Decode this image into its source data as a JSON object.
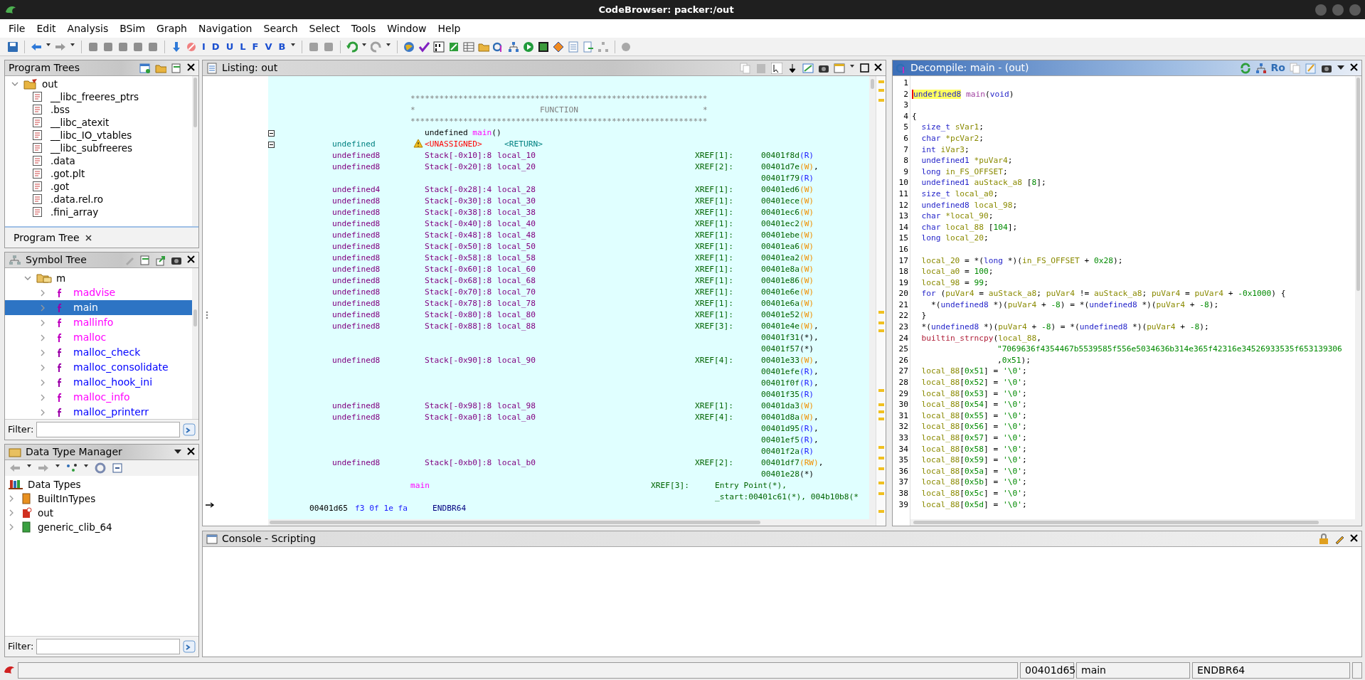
{
  "window": {
    "title": "CodeBrowser: packer:/out"
  },
  "menu": [
    "File",
    "Edit",
    "Analysis",
    "BSim",
    "Graph",
    "Navigation",
    "Search",
    "Select",
    "Tools",
    "Window",
    "Help"
  ],
  "toolbar": {
    "letter_buttons": [
      "I",
      "D",
      "U",
      "L",
      "F",
      "V",
      "B"
    ]
  },
  "program_trees": {
    "title": "Program Trees",
    "root": {
      "label": "out",
      "expanded": true,
      "children": [
        {
          "label": "__libc_freeres_ptrs"
        },
        {
          "label": ".bss"
        },
        {
          "label": "__libc_atexit"
        },
        {
          "label": "__libc_IO_vtables"
        },
        {
          "label": "__libc_subfreeres"
        },
        {
          "label": ".data"
        },
        {
          "label": ".got.plt"
        },
        {
          "label": ".got"
        },
        {
          "label": ".data.rel.ro"
        },
        {
          "label": ".fini_array"
        }
      ]
    },
    "tab": "Program Tree"
  },
  "symbol_tree": {
    "title": "Symbol Tree",
    "folder": {
      "label": "m",
      "expanded": true,
      "children": [
        {
          "label": "madvise",
          "kind": "external",
          "selected": false
        },
        {
          "label": "main",
          "kind": "internal",
          "selected": true
        },
        {
          "label": "mallinfo",
          "kind": "external",
          "selected": false
        },
        {
          "label": "malloc",
          "kind": "external",
          "selected": false
        },
        {
          "label": "malloc_check",
          "kind": "internal",
          "selected": false
        },
        {
          "label": "malloc_consolidate",
          "kind": "internal",
          "selected": false
        },
        {
          "label": "malloc_hook_ini",
          "kind": "internal",
          "selected": false
        },
        {
          "label": "malloc_info",
          "kind": "external",
          "selected": false
        },
        {
          "label": "malloc_printerr",
          "kind": "internal",
          "selected": false
        }
      ]
    },
    "filter": {
      "label": "Filter:"
    }
  },
  "data_type_manager": {
    "title": "Data Type Manager",
    "root": {
      "label": "Data Types",
      "children": [
        {
          "label": "BuiltInTypes",
          "kind": "builtin"
        },
        {
          "label": "out",
          "kind": "program"
        },
        {
          "label": "generic_clib_64",
          "kind": "archive"
        }
      ]
    },
    "filter": {
      "label": "Filter:"
    }
  },
  "listing": {
    "title": "Listing: out",
    "rows": [
      {
        "kind": "separator",
        "text": "**************************************************************"
      },
      {
        "kind": "banner",
        "left": "*",
        "title": "FUNCTION",
        "right": "*"
      },
      {
        "kind": "separator",
        "text": "**************************************************************"
      },
      {
        "kind": "signature",
        "type": "undefined",
        "name": "main",
        "args": "()",
        "collapsible": true
      },
      {
        "kind": "return",
        "type": "undefined",
        "warning": true,
        "storage": "<UNASSIGNED>",
        "name": "<RETURN>",
        "collapsible": true
      },
      {
        "kind": "variable",
        "type": "undefined8",
        "storage": "Stack[-0x10]:8",
        "name": "local_10",
        "xref": "XREF[1]:",
        "refs": [
          {
            "addr": "00401f8d",
            "access": "(R)",
            "kind": "read"
          }
        ]
      },
      {
        "kind": "variable",
        "type": "undefined8",
        "storage": "Stack[-0x20]:8",
        "name": "local_20",
        "xref": "XREF[2]:",
        "refs": [
          {
            "addr": "00401d7e",
            "access": "(W)",
            "kind": "write",
            "sep": ","
          },
          {
            "addr": "00401f79",
            "access": "(R)",
            "kind": "read"
          }
        ]
      },
      {
        "kind": "variable",
        "type": "undefined4",
        "storage": "Stack[-0x28]:4",
        "name": "local_28",
        "xref": "XREF[1]:",
        "refs": [
          {
            "addr": "00401ed6",
            "access": "(W)",
            "kind": "write"
          }
        ]
      },
      {
        "kind": "variable",
        "type": "undefined8",
        "storage": "Stack[-0x30]:8",
        "name": "local_30",
        "xref": "XREF[1]:",
        "refs": [
          {
            "addr": "00401ece",
            "access": "(W)",
            "kind": "write"
          }
        ]
      },
      {
        "kind": "variable",
        "type": "undefined8",
        "storage": "Stack[-0x38]:8",
        "name": "local_38",
        "xref": "XREF[1]:",
        "refs": [
          {
            "addr": "00401ec6",
            "access": "(W)",
            "kind": "write"
          }
        ]
      },
      {
        "kind": "variable",
        "type": "undefined8",
        "storage": "Stack[-0x40]:8",
        "name": "local_40",
        "xref": "XREF[1]:",
        "refs": [
          {
            "addr": "00401ec2",
            "access": "(W)",
            "kind": "write"
          }
        ]
      },
      {
        "kind": "variable",
        "type": "undefined8",
        "storage": "Stack[-0x48]:8",
        "name": "local_48",
        "xref": "XREF[1]:",
        "refs": [
          {
            "addr": "00401ebe",
            "access": "(W)",
            "kind": "write"
          }
        ]
      },
      {
        "kind": "variable",
        "type": "undefined8",
        "storage": "Stack[-0x50]:8",
        "name": "local_50",
        "xref": "XREF[1]:",
        "refs": [
          {
            "addr": "00401ea6",
            "access": "(W)",
            "kind": "write"
          }
        ]
      },
      {
        "kind": "variable",
        "type": "undefined8",
        "storage": "Stack[-0x58]:8",
        "name": "local_58",
        "xref": "XREF[1]:",
        "refs": [
          {
            "addr": "00401ea2",
            "access": "(W)",
            "kind": "write"
          }
        ]
      },
      {
        "kind": "variable",
        "type": "undefined8",
        "storage": "Stack[-0x60]:8",
        "name": "local_60",
        "xref": "XREF[1]:",
        "refs": [
          {
            "addr": "00401e8a",
            "access": "(W)",
            "kind": "write"
          }
        ]
      },
      {
        "kind": "variable",
        "type": "undefined8",
        "storage": "Stack[-0x68]:8",
        "name": "local_68",
        "xref": "XREF[1]:",
        "refs": [
          {
            "addr": "00401e86",
            "access": "(W)",
            "kind": "write"
          }
        ]
      },
      {
        "kind": "variable",
        "type": "undefined8",
        "storage": "Stack[-0x70]:8",
        "name": "local_70",
        "xref": "XREF[1]:",
        "refs": [
          {
            "addr": "00401e6e",
            "access": "(W)",
            "kind": "write"
          }
        ]
      },
      {
        "kind": "variable",
        "type": "undefined8",
        "storage": "Stack[-0x78]:8",
        "name": "local_78",
        "xref": "XREF[1]:",
        "refs": [
          {
            "addr": "00401e6a",
            "access": "(W)",
            "kind": "write"
          }
        ]
      },
      {
        "kind": "variable",
        "type": "undefined8",
        "storage": "Stack[-0x80]:8",
        "name": "local_80",
        "xref": "XREF[1]:",
        "refs": [
          {
            "addr": "00401e52",
            "access": "(W)",
            "kind": "write"
          }
        ]
      },
      {
        "kind": "variable",
        "type": "undefined8",
        "storage": "Stack[-0x88]:8",
        "name": "local_88",
        "xref": "XREF[3]:",
        "refs": [
          {
            "addr": "00401e4e",
            "access": "(W)",
            "kind": "write",
            "sep": ","
          },
          {
            "addr": "00401f31",
            "access": "(*)",
            "kind": "pointer",
            "sep": ","
          },
          {
            "addr": "00401f57",
            "access": "(*)",
            "kind": "pointer"
          }
        ]
      },
      {
        "kind": "variable",
        "type": "undefined8",
        "storage": "Stack[-0x90]:8",
        "name": "local_90",
        "xref": "XREF[4]:",
        "refs": [
          {
            "addr": "00401e33",
            "access": "(W)",
            "kind": "write",
            "sep": ","
          },
          {
            "addr": "00401efe",
            "access": "(R)",
            "kind": "read",
            "sep": ","
          },
          {
            "addr": "00401f0f",
            "access": "(R)",
            "kind": "read",
            "sep": ","
          },
          {
            "addr": "00401f35",
            "access": "(R)",
            "kind": "read"
          }
        ]
      },
      {
        "kind": "variable",
        "type": "undefined8",
        "storage": "Stack[-0x98]:8",
        "name": "local_98",
        "xref": "XREF[1]:",
        "refs": [
          {
            "addr": "00401da3",
            "access": "(W)",
            "kind": "write"
          }
        ]
      },
      {
        "kind": "variable",
        "type": "undefined8",
        "storage": "Stack[-0xa0]:8",
        "name": "local_a0",
        "xref": "XREF[4]:",
        "refs": [
          {
            "addr": "00401d8a",
            "access": "(W)",
            "kind": "write",
            "sep": ","
          },
          {
            "addr": "00401d95",
            "access": "(R)",
            "kind": "read",
            "sep": ","
          },
          {
            "addr": "00401ef5",
            "access": "(R)",
            "kind": "read",
            "sep": ","
          },
          {
            "addr": "00401f2a",
            "access": "(R)",
            "kind": "read"
          }
        ]
      },
      {
        "kind": "variable",
        "type": "undefined8",
        "storage": "Stack[-0xb0]:8",
        "name": "local_b0",
        "xref": "XREF[2]:",
        "refs": [
          {
            "addr": "00401df7",
            "access": "(RW)",
            "kind": "readwrite",
            "sep": ","
          },
          {
            "addr": "00401e28",
            "access": "(*)",
            "kind": "pointer"
          }
        ]
      },
      {
        "kind": "label",
        "name": "main",
        "xref": "XREF[3]:",
        "refs": [
          "Entry Point(*),",
          "_start:00401c61(*), 004b10b8(*"
        ]
      },
      {
        "kind": "instruction",
        "address": "00401d65",
        "bytes": "f3 0f 1e fa",
        "mnemonic": "ENDBR64"
      }
    ]
  },
  "decompile": {
    "title": "Decompile: main - (out)",
    "toolbar_label": "Ro",
    "lines": [
      {
        "number": "1",
        "kind": "top"
      },
      {
        "number": "2",
        "kind": "top",
        "tokens": [
          {
            "text": "undefined8",
            "kind": "highlight"
          },
          {
            "text": " main",
            "kind": "func"
          },
          {
            "text": "(",
            "kind": "plain"
          },
          {
            "text": "void",
            "kind": "type"
          },
          {
            "text": ")",
            "kind": "plain"
          }
        ]
      },
      {
        "number": "3",
        "kind": "top"
      },
      {
        "number": "4",
        "kind": "top",
        "tokens": [
          {
            "text": "{",
            "kind": "plain"
          }
        ]
      },
      {
        "number": "5",
        "kind": "body",
        "tokens": [
          {
            "text": "size_t",
            "kind": "type"
          },
          {
            "text": " sVar1",
            "kind": "var"
          },
          {
            "text": ";",
            "kind": "plain"
          }
        ]
      },
      {
        "number": "6",
        "kind": "body",
        "tokens": [
          {
            "text": "char",
            "kind": "type"
          },
          {
            "text": " *pcVar2",
            "kind": "var"
          },
          {
            "text": ";",
            "kind": "plain"
          }
        ]
      },
      {
        "number": "7",
        "kind": "body",
        "tokens": [
          {
            "text": "int",
            "kind": "type"
          },
          {
            "text": " iVar3",
            "kind": "var"
          },
          {
            "text": ";",
            "kind": "plain"
          }
        ]
      },
      {
        "number": "8",
        "kind": "body",
        "tokens": [
          {
            "text": "undefined1",
            "kind": "type"
          },
          {
            "text": " *puVar4",
            "kind": "var"
          },
          {
            "text": ";",
            "kind": "plain"
          }
        ]
      },
      {
        "number": "9",
        "kind": "body",
        "tokens": [
          {
            "text": "long",
            "kind": "type"
          },
          {
            "text": " in_FS_OFFSET",
            "kind": "var"
          },
          {
            "text": ";",
            "kind": "plain"
          }
        ]
      },
      {
        "number": "10",
        "kind": "body",
        "tokens": [
          {
            "text": "undefined1",
            "kind": "type"
          },
          {
            "text": " auStack_a8",
            "kind": "var"
          },
          {
            "text": " [",
            "kind": "plain"
          },
          {
            "text": "8",
            "kind": "num"
          },
          {
            "text": "];",
            "kind": "plain"
          }
        ]
      },
      {
        "number": "11",
        "kind": "body",
        "tokens": [
          {
            "text": "size_t",
            "kind": "type"
          },
          {
            "text": " local_a0",
            "kind": "var"
          },
          {
            "text": ";",
            "kind": "plain"
          }
        ]
      },
      {
        "number": "12",
        "kind": "body",
        "tokens": [
          {
            "text": "undefined8",
            "kind": "type"
          },
          {
            "text": " local_98",
            "kind": "var"
          },
          {
            "text": ";",
            "kind": "plain"
          }
        ]
      },
      {
        "number": "13",
        "kind": "body",
        "tokens": [
          {
            "text": "char",
            "kind": "type"
          },
          {
            "text": " *local_90",
            "kind": "var"
          },
          {
            "text": ";",
            "kind": "plain"
          }
        ]
      },
      {
        "number": "14",
        "kind": "body",
        "tokens": [
          {
            "text": "char",
            "kind": "type"
          },
          {
            "text": " local_88",
            "kind": "var"
          },
          {
            "text": " [",
            "kind": "plain"
          },
          {
            "text": "104",
            "kind": "num"
          },
          {
            "text": "];",
            "kind": "plain"
          }
        ]
      },
      {
        "number": "15",
        "kind": "body",
        "tokens": [
          {
            "text": "long",
            "kind": "type"
          },
          {
            "text": " local_20",
            "kind": "var"
          },
          {
            "text": ";",
            "kind": "plain"
          }
        ]
      },
      {
        "number": "16",
        "kind": "top"
      },
      {
        "number": "17",
        "kind": "body",
        "tokens": [
          {
            "text": "local_20",
            "kind": "var"
          },
          {
            "text": " = *(",
            "kind": "plain"
          },
          {
            "text": "long",
            "kind": "type"
          },
          {
            "text": " *)(",
            "kind": "plain"
          },
          {
            "text": "in_FS_OFFSET",
            "kind": "var"
          },
          {
            "text": " + ",
            "kind": "plain"
          },
          {
            "text": "0x28",
            "kind": "num"
          },
          {
            "text": ");",
            "kind": "plain"
          }
        ]
      },
      {
        "number": "18",
        "kind": "body",
        "tokens": [
          {
            "text": "local_a0",
            "kind": "var"
          },
          {
            "text": " = ",
            "kind": "plain"
          },
          {
            "text": "100",
            "kind": "num"
          },
          {
            "text": ";",
            "kind": "plain"
          }
        ]
      },
      {
        "number": "19",
        "kind": "body",
        "tokens": [
          {
            "text": "local_98",
            "kind": "var"
          },
          {
            "text": " = ",
            "kind": "plain"
          },
          {
            "text": "99",
            "kind": "num"
          },
          {
            "text": ";",
            "kind": "plain"
          }
        ]
      },
      {
        "number": "20",
        "kind": "body",
        "tokens": [
          {
            "text": "for",
            "kind": "type"
          },
          {
            "text": " (",
            "kind": "plain"
          },
          {
            "text": "puVar4",
            "kind": "var"
          },
          {
            "text": " = ",
            "kind": "plain"
          },
          {
            "text": "auStack_a8",
            "kind": "var"
          },
          {
            "text": "; ",
            "kind": "plain"
          },
          {
            "text": "puVar4",
            "kind": "var"
          },
          {
            "text": " != ",
            "kind": "plain"
          },
          {
            "text": "auStack_a8",
            "kind": "var"
          },
          {
            "text": "; ",
            "kind": "plain"
          },
          {
            "text": "puVar4",
            "kind": "var"
          },
          {
            "text": " = ",
            "kind": "plain"
          },
          {
            "text": "puVar4",
            "kind": "var"
          },
          {
            "text": " + ",
            "kind": "plain"
          },
          {
            "text": "-0x1000",
            "kind": "num"
          },
          {
            "text": ") {",
            "kind": "plain"
          }
        ]
      },
      {
        "number": "21",
        "kind": "inner",
        "tokens": [
          {
            "text": "*(",
            "kind": "plain"
          },
          {
            "text": "undefined8",
            "kind": "type"
          },
          {
            "text": " *)(",
            "kind": "plain"
          },
          {
            "text": "puVar4",
            "kind": "var"
          },
          {
            "text": " + ",
            "kind": "plain"
          },
          {
            "text": "-8",
            "kind": "num"
          },
          {
            "text": ") = *(",
            "kind": "plain"
          },
          {
            "text": "undefined8",
            "kind": "type"
          },
          {
            "text": " *)(",
            "kind": "plain"
          },
          {
            "text": "puVar4",
            "kind": "var"
          },
          {
            "text": " + ",
            "kind": "plain"
          },
          {
            "text": "-8",
            "kind": "num"
          },
          {
            "text": ");",
            "kind": "plain"
          }
        ]
      },
      {
        "number": "22",
        "kind": "body",
        "tokens": [
          {
            "text": "}",
            "kind": "plain"
          }
        ]
      },
      {
        "number": "23",
        "kind": "body",
        "tokens": [
          {
            "text": "*(",
            "kind": "plain"
          },
          {
            "text": "undefined8",
            "kind": "type"
          },
          {
            "text": " *)(",
            "kind": "plain"
          },
          {
            "text": "puVar4",
            "kind": "var"
          },
          {
            "text": " + ",
            "kind": "plain"
          },
          {
            "text": "-8",
            "kind": "num"
          },
          {
            "text": ") = *(",
            "kind": "plain"
          },
          {
            "text": "undefined8",
            "kind": "type"
          },
          {
            "text": " *)(",
            "kind": "plain"
          },
          {
            "text": "puVar4",
            "kind": "var"
          },
          {
            "text": " + ",
            "kind": "plain"
          },
          {
            "text": "-8",
            "kind": "num"
          },
          {
            "text": ");",
            "kind": "plain"
          }
        ]
      },
      {
        "number": "24",
        "kind": "body",
        "tokens": [
          {
            "text": "builtin_strncpy",
            "kind": "callee"
          },
          {
            "text": "(",
            "kind": "plain"
          },
          {
            "text": "local_88",
            "kind": "var"
          },
          {
            "text": ",",
            "kind": "plain"
          }
        ]
      },
      {
        "number": "25",
        "kind": "continued",
        "tokens": [
          {
            "text": "\"7069636f4354467b5539585f556e5034636b314e365f42316e34526933535f653139306",
            "kind": "str"
          }
        ]
      },
      {
        "number": "26",
        "kind": "continued",
        "tokens": [
          {
            "text": ",",
            "kind": "plain"
          },
          {
            "text": "0x51",
            "kind": "num"
          },
          {
            "text": ");",
            "kind": "plain"
          }
        ]
      },
      {
        "number": "27",
        "kind": "body",
        "tokens": [
          {
            "text": "local_88",
            "kind": "var"
          },
          {
            "text": "[",
            "kind": "plain"
          },
          {
            "text": "0x51",
            "kind": "num"
          },
          {
            "text": "] = ",
            "kind": "plain"
          },
          {
            "text": "'\\0'",
            "kind": "str"
          },
          {
            "text": ";",
            "kind": "plain"
          }
        ]
      },
      {
        "number": "28",
        "kind": "body",
        "tokens": [
          {
            "text": "local_88",
            "kind": "var"
          },
          {
            "text": "[",
            "kind": "plain"
          },
          {
            "text": "0x52",
            "kind": "num"
          },
          {
            "text": "] = ",
            "kind": "plain"
          },
          {
            "text": "'\\0'",
            "kind": "str"
          },
          {
            "text": ";",
            "kind": "plain"
          }
        ]
      },
      {
        "number": "29",
        "kind": "body",
        "tokens": [
          {
            "text": "local_88",
            "kind": "var"
          },
          {
            "text": "[",
            "kind": "plain"
          },
          {
            "text": "0x53",
            "kind": "num"
          },
          {
            "text": "] = ",
            "kind": "plain"
          },
          {
            "text": "'\\0'",
            "kind": "str"
          },
          {
            "text": ";",
            "kind": "plain"
          }
        ]
      },
      {
        "number": "30",
        "kind": "body",
        "tokens": [
          {
            "text": "local_88",
            "kind": "var"
          },
          {
            "text": "[",
            "kind": "plain"
          },
          {
            "text": "0x54",
            "kind": "num"
          },
          {
            "text": "] = ",
            "kind": "plain"
          },
          {
            "text": "'\\0'",
            "kind": "str"
          },
          {
            "text": ";",
            "kind": "plain"
          }
        ]
      },
      {
        "number": "31",
        "kind": "body",
        "tokens": [
          {
            "text": "local_88",
            "kind": "var"
          },
          {
            "text": "[",
            "kind": "plain"
          },
          {
            "text": "0x55",
            "kind": "num"
          },
          {
            "text": "] = ",
            "kind": "plain"
          },
          {
            "text": "'\\0'",
            "kind": "str"
          },
          {
            "text": ";",
            "kind": "plain"
          }
        ]
      },
      {
        "number": "32",
        "kind": "body",
        "tokens": [
          {
            "text": "local_88",
            "kind": "var"
          },
          {
            "text": "[",
            "kind": "plain"
          },
          {
            "text": "0x56",
            "kind": "num"
          },
          {
            "text": "] = ",
            "kind": "plain"
          },
          {
            "text": "'\\0'",
            "kind": "str"
          },
          {
            "text": ";",
            "kind": "plain"
          }
        ]
      },
      {
        "number": "33",
        "kind": "body",
        "tokens": [
          {
            "text": "local_88",
            "kind": "var"
          },
          {
            "text": "[",
            "kind": "plain"
          },
          {
            "text": "0x57",
            "kind": "num"
          },
          {
            "text": "] = ",
            "kind": "plain"
          },
          {
            "text": "'\\0'",
            "kind": "str"
          },
          {
            "text": ";",
            "kind": "plain"
          }
        ]
      },
      {
        "number": "34",
        "kind": "body",
        "tokens": [
          {
            "text": "local_88",
            "kind": "var"
          },
          {
            "text": "[",
            "kind": "plain"
          },
          {
            "text": "0x58",
            "kind": "num"
          },
          {
            "text": "] = ",
            "kind": "plain"
          },
          {
            "text": "'\\0'",
            "kind": "str"
          },
          {
            "text": ";",
            "kind": "plain"
          }
        ]
      },
      {
        "number": "35",
        "kind": "body",
        "tokens": [
          {
            "text": "local_88",
            "kind": "var"
          },
          {
            "text": "[",
            "kind": "plain"
          },
          {
            "text": "0x59",
            "kind": "num"
          },
          {
            "text": "] = ",
            "kind": "plain"
          },
          {
            "text": "'\\0'",
            "kind": "str"
          },
          {
            "text": ";",
            "kind": "plain"
          }
        ]
      },
      {
        "number": "36",
        "kind": "body",
        "tokens": [
          {
            "text": "local_88",
            "kind": "var"
          },
          {
            "text": "[",
            "kind": "plain"
          },
          {
            "text": "0x5a",
            "kind": "num"
          },
          {
            "text": "] = ",
            "kind": "plain"
          },
          {
            "text": "'\\0'",
            "kind": "str"
          },
          {
            "text": ";",
            "kind": "plain"
          }
        ]
      },
      {
        "number": "37",
        "kind": "body",
        "tokens": [
          {
            "text": "local_88",
            "kind": "var"
          },
          {
            "text": "[",
            "kind": "plain"
          },
          {
            "text": "0x5b",
            "kind": "num"
          },
          {
            "text": "] = ",
            "kind": "plain"
          },
          {
            "text": "'\\0'",
            "kind": "str"
          },
          {
            "text": ";",
            "kind": "plain"
          }
        ]
      },
      {
        "number": "38",
        "kind": "body",
        "tokens": [
          {
            "text": "local_88",
            "kind": "var"
          },
          {
            "text": "[",
            "kind": "plain"
          },
          {
            "text": "0x5c",
            "kind": "num"
          },
          {
            "text": "] = ",
            "kind": "plain"
          },
          {
            "text": "'\\0'",
            "kind": "str"
          },
          {
            "text": ";",
            "kind": "plain"
          }
        ]
      },
      {
        "number": "39",
        "kind": "body",
        "tokens": [
          {
            "text": "local_88",
            "kind": "var"
          },
          {
            "text": "[",
            "kind": "plain"
          },
          {
            "text": "0x5d",
            "kind": "num"
          },
          {
            "text": "] = ",
            "kind": "plain"
          },
          {
            "text": "'\\0'",
            "kind": "str"
          },
          {
            "text": ";",
            "kind": "plain"
          }
        ]
      }
    ]
  },
  "console": {
    "title": "Console - Scripting"
  },
  "status_bar": {
    "fields": [
      "00401d65",
      "main",
      "ENDBR64"
    ]
  }
}
